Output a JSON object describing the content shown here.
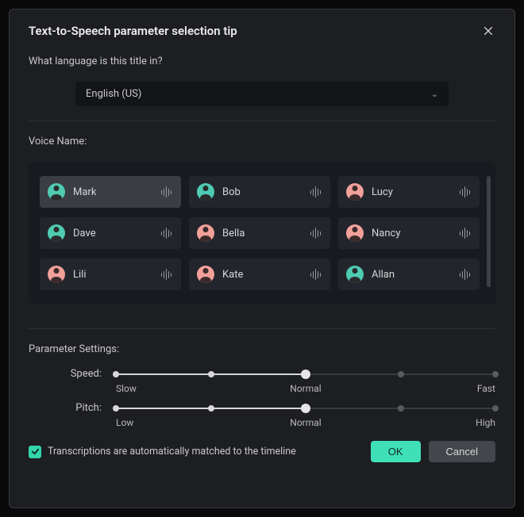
{
  "dialog": {
    "title": "Text-to-Speech parameter selection tip"
  },
  "language": {
    "question": "What language is this title in?",
    "selected": "English (US)"
  },
  "voice": {
    "label": "Voice Name:",
    "items": [
      {
        "name": "Mark",
        "avatar": "green",
        "selected": true
      },
      {
        "name": "Bob",
        "avatar": "green",
        "selected": false
      },
      {
        "name": "Lucy",
        "avatar": "pink",
        "selected": false
      },
      {
        "name": "Dave",
        "avatar": "green",
        "selected": false
      },
      {
        "name": "Bella",
        "avatar": "pink",
        "selected": false
      },
      {
        "name": "Nancy",
        "avatar": "pink",
        "selected": false
      },
      {
        "name": "Lili",
        "avatar": "pink",
        "selected": false
      },
      {
        "name": "Kate",
        "avatar": "pink",
        "selected": false
      },
      {
        "name": "Allan",
        "avatar": "green",
        "selected": false
      }
    ]
  },
  "params": {
    "title": "Parameter Settings:",
    "speed": {
      "label": "Speed:",
      "low": "Slow",
      "mid": "Normal",
      "high": "Fast",
      "value_pct": 50
    },
    "pitch": {
      "label": "Pitch:",
      "low": "Low",
      "mid": "Normal",
      "high": "High",
      "value_pct": 50
    }
  },
  "footer": {
    "checkbox_label": "Transcriptions are automatically matched to the timeline",
    "checked": true,
    "ok": "OK",
    "cancel": "Cancel"
  }
}
